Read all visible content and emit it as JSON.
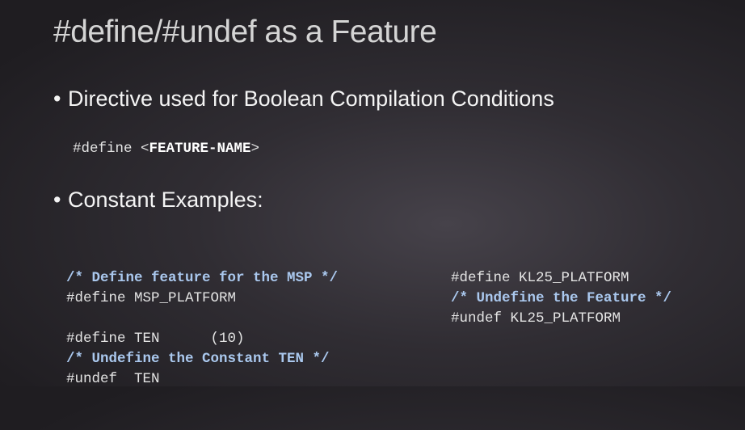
{
  "slide": {
    "title": "#define/#undef as a Feature",
    "bullet_dot": "•",
    "bullets": [
      "Directive used for Boolean Compilation Conditions",
      "Constant Examples:"
    ],
    "syntax": {
      "prefix": "#define <",
      "name": "FEATURE-NAME",
      "suffix": ">"
    },
    "left_code": [
      "/* Define feature for the MSP */",
      "#define MSP_PLATFORM",
      "",
      "#define TEN      (10)",
      "/* Undefine the Constant TEN */",
      "#undef  TEN"
    ],
    "right_code": [
      "#define KL25_PLATFORM",
      "/* Undefine the Feature */",
      "#undef KL25_PLATFORM"
    ]
  }
}
